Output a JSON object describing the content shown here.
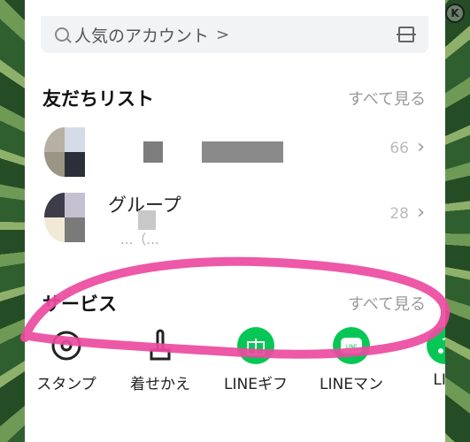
{
  "header": {
    "right_icons": [
      "K",
      "K"
    ]
  },
  "search": {
    "placeholder": "人気のアカウント",
    "chevron": ">"
  },
  "friends": {
    "title": "友だちリスト",
    "see_all": "すべて見る",
    "items": [
      {
        "name": "",
        "count": "66",
        "subtitle": ""
      },
      {
        "name": "グループ",
        "count": "28",
        "subtitle": "...（..."
      }
    ]
  },
  "services": {
    "title": "サービス",
    "see_all": "すべて見る",
    "items": [
      {
        "label": "スタンプ",
        "icon": "sticker-icon"
      },
      {
        "label": "着せかえ",
        "icon": "theme-icon"
      },
      {
        "label": "LINEギフ",
        "icon": "gift-icon"
      },
      {
        "label": "LINEマン",
        "icon": "manga-icon"
      },
      {
        "label": "LIN",
        "icon": "music-icon"
      }
    ]
  },
  "colors": {
    "line_green": "#06c755",
    "highlight": "#ec4aa0"
  }
}
